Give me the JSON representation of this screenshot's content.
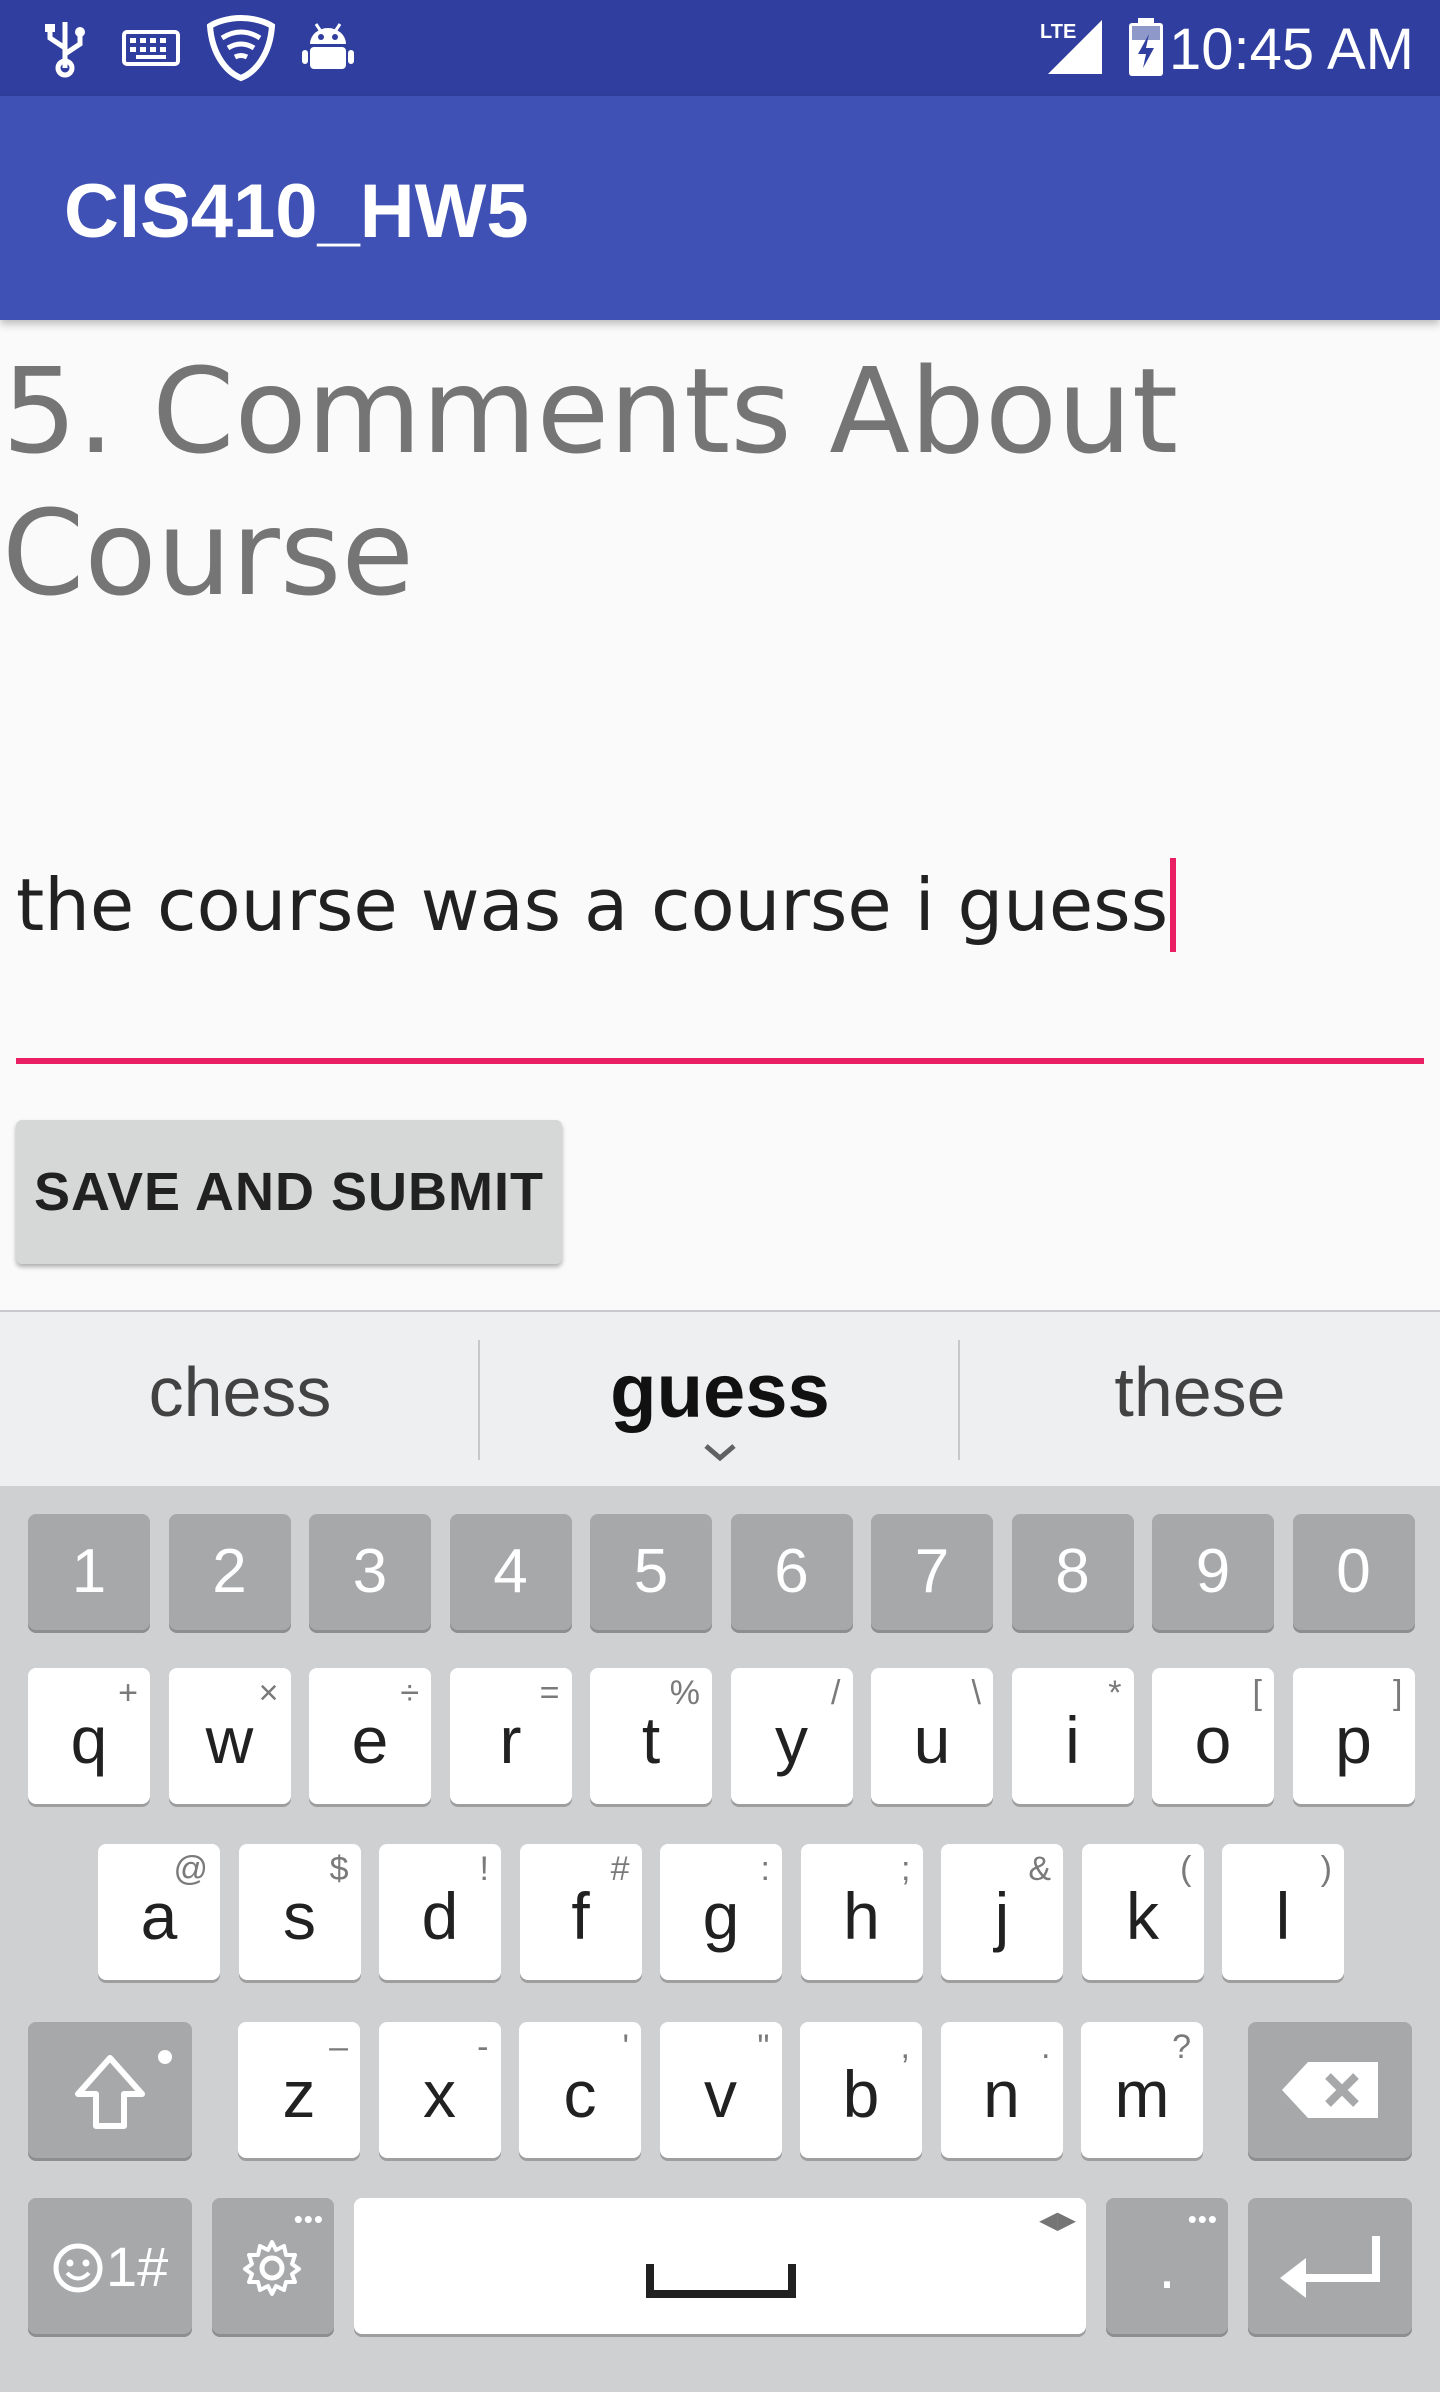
{
  "status_bar": {
    "time": "10:45 AM",
    "network": "LTE",
    "icons": [
      "usb-icon",
      "keyboard-icon",
      "vpn-shield-icon",
      "android-debug-icon",
      "lte-signal-icon",
      "battery-charging-icon"
    ]
  },
  "app_bar": {
    "title": "CIS410_HW5"
  },
  "question": {
    "heading": "5. Comments About Course"
  },
  "comment": {
    "value": "the course was a course i guess"
  },
  "submit": {
    "label": "SAVE AND SUBMIT"
  },
  "keyboard": {
    "suggestions": [
      "chess",
      "guess",
      "these"
    ],
    "number_row": [
      "1",
      "2",
      "3",
      "4",
      "5",
      "6",
      "7",
      "8",
      "9",
      "0"
    ],
    "row1": [
      {
        "key": "q",
        "sub": "+"
      },
      {
        "key": "w",
        "sub": "×"
      },
      {
        "key": "e",
        "sub": "÷"
      },
      {
        "key": "r",
        "sub": "="
      },
      {
        "key": "t",
        "sub": "%"
      },
      {
        "key": "y",
        "sub": "/"
      },
      {
        "key": "u",
        "sub": "\\"
      },
      {
        "key": "i",
        "sub": "*"
      },
      {
        "key": "o",
        "sub": "["
      },
      {
        "key": "p",
        "sub": "]"
      }
    ],
    "row2": [
      {
        "key": "a",
        "sub": "@"
      },
      {
        "key": "s",
        "sub": "$"
      },
      {
        "key": "d",
        "sub": "!"
      },
      {
        "key": "f",
        "sub": "#"
      },
      {
        "key": "g",
        "sub": ":"
      },
      {
        "key": "h",
        "sub": ";"
      },
      {
        "key": "j",
        "sub": "&"
      },
      {
        "key": "k",
        "sub": "("
      },
      {
        "key": "l",
        "sub": ")"
      }
    ],
    "row3": [
      {
        "key": "z",
        "sub": "–"
      },
      {
        "key": "x",
        "sub": "-"
      },
      {
        "key": "c",
        "sub": "'"
      },
      {
        "key": "v",
        "sub": "\""
      },
      {
        "key": "b",
        "sub": ","
      },
      {
        "key": "n",
        "sub": "."
      },
      {
        "key": "m",
        "sub": "?"
      }
    ],
    "symbols_label": "1#",
    "period_label": ".",
    "accent_color": "#e91e63",
    "primary_color": "#3f51b5"
  }
}
